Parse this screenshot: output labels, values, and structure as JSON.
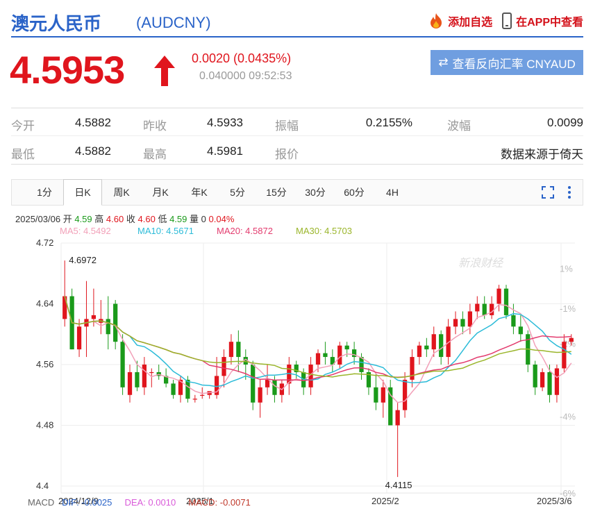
{
  "header": {
    "title": "澳元人民币",
    "code": "(AUDCNY)",
    "add_watchlist": "添加自选",
    "view_in_app": "在APP中查看"
  },
  "quote": {
    "price": "4.5953",
    "change": "0.0020 (0.0435%)",
    "sub": "0.040000 09:52:53",
    "reverse_button": "查看反向汇率 CNYAUD",
    "up_color": "#e0151d"
  },
  "stats": {
    "open_label": "今开",
    "open_value": "4.5882",
    "prev_close_label": "昨收",
    "prev_close_value": "4.5933",
    "amplitude_label": "振幅",
    "amplitude_value": "0.2155%",
    "wave_label": "波幅",
    "wave_value": "0.0099",
    "low_label": "最低",
    "low_value": "4.5882",
    "high_label": "最高",
    "high_value": "4.5981",
    "quote_label": "报价",
    "source": "数据来源于倚天"
  },
  "tabs": [
    "1分",
    "日K",
    "周K",
    "月K",
    "年K",
    "5分",
    "15分",
    "30分",
    "60分",
    "4H"
  ],
  "active_tab": "日K",
  "ohlc": {
    "date": "2025/03/06",
    "open_label": "开",
    "open": "4.59",
    "high_label": "高",
    "high": "4.60",
    "close_label": "收",
    "close": "4.60",
    "low_label": "低",
    "low": "4.59",
    "vol_label": "量",
    "vol": "0",
    "pct": "0.04%"
  },
  "ma": {
    "ma5": "MA5: 4.5492",
    "ma10": "MA10: 4.5671",
    "ma20": "MA20: 4.5872",
    "ma30": "MA30: 4.5703"
  },
  "macd": {
    "label": "MACD",
    "dif": "DIF: -0.0025",
    "dea": "DEA: 0.0010",
    "macd": "MACD: -0.0071"
  },
  "colors": {
    "ma5": "#f2a0b8",
    "ma10": "#2bbbd8",
    "ma20": "#e33b6e",
    "ma30": "#9ab52a",
    "up": "#e0151d",
    "down": "#1a9a1a",
    "accent": "#2a63c8"
  },
  "chart_data": {
    "type": "candlestick",
    "y_ticks": [
      "4.72",
      "4.64",
      "4.56",
      "4.48",
      "4.4"
    ],
    "pct_ticks": [
      "1%",
      "-1%",
      "-2%",
      "-4%",
      "-6%"
    ],
    "x_ticks": [
      "2024/12/9",
      "2025/1",
      "2025/2",
      "2025/3/6"
    ],
    "annotations": {
      "max": "4.6972",
      "min": "4.4115"
    },
    "watermark": "新浪财经",
    "ylim": [
      4.4,
      4.72
    ],
    "candles": [
      [
        4.62,
        4.697,
        4.61,
        4.65
      ],
      [
        4.65,
        4.66,
        4.58,
        4.58
      ],
      [
        4.58,
        4.62,
        4.57,
        4.61
      ],
      [
        4.61,
        4.67,
        4.57,
        4.62
      ],
      [
        4.62,
        4.66,
        4.61,
        4.625
      ],
      [
        4.615,
        4.645,
        4.6,
        4.62
      ],
      [
        4.62,
        4.65,
        4.58,
        4.6
      ],
      [
        4.64,
        4.645,
        4.58,
        4.59
      ],
      [
        4.59,
        4.6,
        4.52,
        4.53
      ],
      [
        4.52,
        4.56,
        4.51,
        4.55
      ],
      [
        4.55,
        4.565,
        4.525,
        4.53
      ],
      [
        4.53,
        4.57,
        4.52,
        4.56
      ],
      [
        4.55,
        4.555,
        4.53,
        4.55
      ],
      [
        4.55,
        4.56,
        4.54,
        4.545
      ],
      [
        4.545,
        4.555,
        4.53,
        4.535
      ],
      [
        4.535,
        4.54,
        4.515,
        4.52
      ],
      [
        4.52,
        4.545,
        4.51,
        4.54
      ],
      [
        4.54,
        4.545,
        4.51,
        4.515
      ],
      [
        4.515,
        4.52,
        4.51,
        4.515
      ],
      [
        4.52,
        4.53,
        4.515,
        4.52
      ],
      [
        4.52,
        4.52,
        4.515,
        4.525
      ],
      [
        4.52,
        4.57,
        4.515,
        4.545
      ],
      [
        4.545,
        4.58,
        4.53,
        4.57
      ],
      [
        4.57,
        4.6,
        4.56,
        4.59
      ],
      [
        4.59,
        4.605,
        4.55,
        4.57
      ],
      [
        4.57,
        4.58,
        4.54,
        4.56
      ],
      [
        4.56,
        4.565,
        4.5,
        4.51
      ],
      [
        4.51,
        4.54,
        4.49,
        4.53
      ],
      [
        4.53,
        4.56,
        4.52,
        4.54
      ],
      [
        4.54,
        4.545,
        4.51,
        4.52
      ],
      [
        4.52,
        4.54,
        4.51,
        4.535
      ],
      [
        4.535,
        4.57,
        4.52,
        4.56
      ],
      [
        4.56,
        4.565,
        4.54,
        4.55
      ],
      [
        4.55,
        4.555,
        4.52,
        4.53
      ],
      [
        4.53,
        4.57,
        4.52,
        4.56
      ],
      [
        4.56,
        4.58,
        4.55,
        4.575
      ],
      [
        4.575,
        4.59,
        4.56,
        4.57
      ],
      [
        4.57,
        4.58,
        4.55,
        4.56
      ],
      [
        4.56,
        4.59,
        4.555,
        4.585
      ],
      [
        4.585,
        4.59,
        4.57,
        4.58
      ],
      [
        4.58,
        4.59,
        4.56,
        4.57
      ],
      [
        4.57,
        4.575,
        4.54,
        4.55
      ],
      [
        4.55,
        4.555,
        4.52,
        4.53
      ],
      [
        4.53,
        4.55,
        4.5,
        4.51
      ],
      [
        4.51,
        4.54,
        4.49,
        4.53
      ],
      [
        4.53,
        4.54,
        4.48,
        4.48
      ],
      [
        4.48,
        4.51,
        4.412,
        4.5
      ],
      [
        4.5,
        4.55,
        4.49,
        4.54
      ],
      [
        4.54,
        4.58,
        4.53,
        4.57
      ],
      [
        4.57,
        4.59,
        4.56,
        4.585
      ],
      [
        4.585,
        4.595,
        4.57,
        4.58
      ],
      [
        4.58,
        4.61,
        4.57,
        4.6
      ],
      [
        4.6,
        4.605,
        4.56,
        4.57
      ],
      [
        4.57,
        4.62,
        4.56,
        4.61
      ],
      [
        4.61,
        4.63,
        4.6,
        4.62
      ],
      [
        4.62,
        4.63,
        4.6,
        4.61
      ],
      [
        4.61,
        4.64,
        4.6,
        4.63
      ],
      [
        4.63,
        4.65,
        4.62,
        4.64
      ],
      [
        4.64,
        4.65,
        4.62,
        4.625
      ],
      [
        4.625,
        4.65,
        4.62,
        4.64
      ],
      [
        4.64,
        4.665,
        4.63,
        4.66
      ],
      [
        4.66,
        4.665,
        4.62,
        4.625
      ],
      [
        4.625,
        4.64,
        4.6,
        4.61
      ],
      [
        4.61,
        4.625,
        4.59,
        4.6
      ],
      [
        4.6,
        4.605,
        4.55,
        4.56
      ],
      [
        4.56,
        4.565,
        4.52,
        4.53
      ],
      [
        4.53,
        4.555,
        4.525,
        4.55
      ],
      [
        4.55,
        4.56,
        4.51,
        4.52
      ],
      [
        4.52,
        4.56,
        4.51,
        4.555
      ],
      [
        4.555,
        4.6,
        4.55,
        4.59
      ],
      [
        4.59,
        4.6,
        4.585,
        4.595
      ]
    ]
  }
}
